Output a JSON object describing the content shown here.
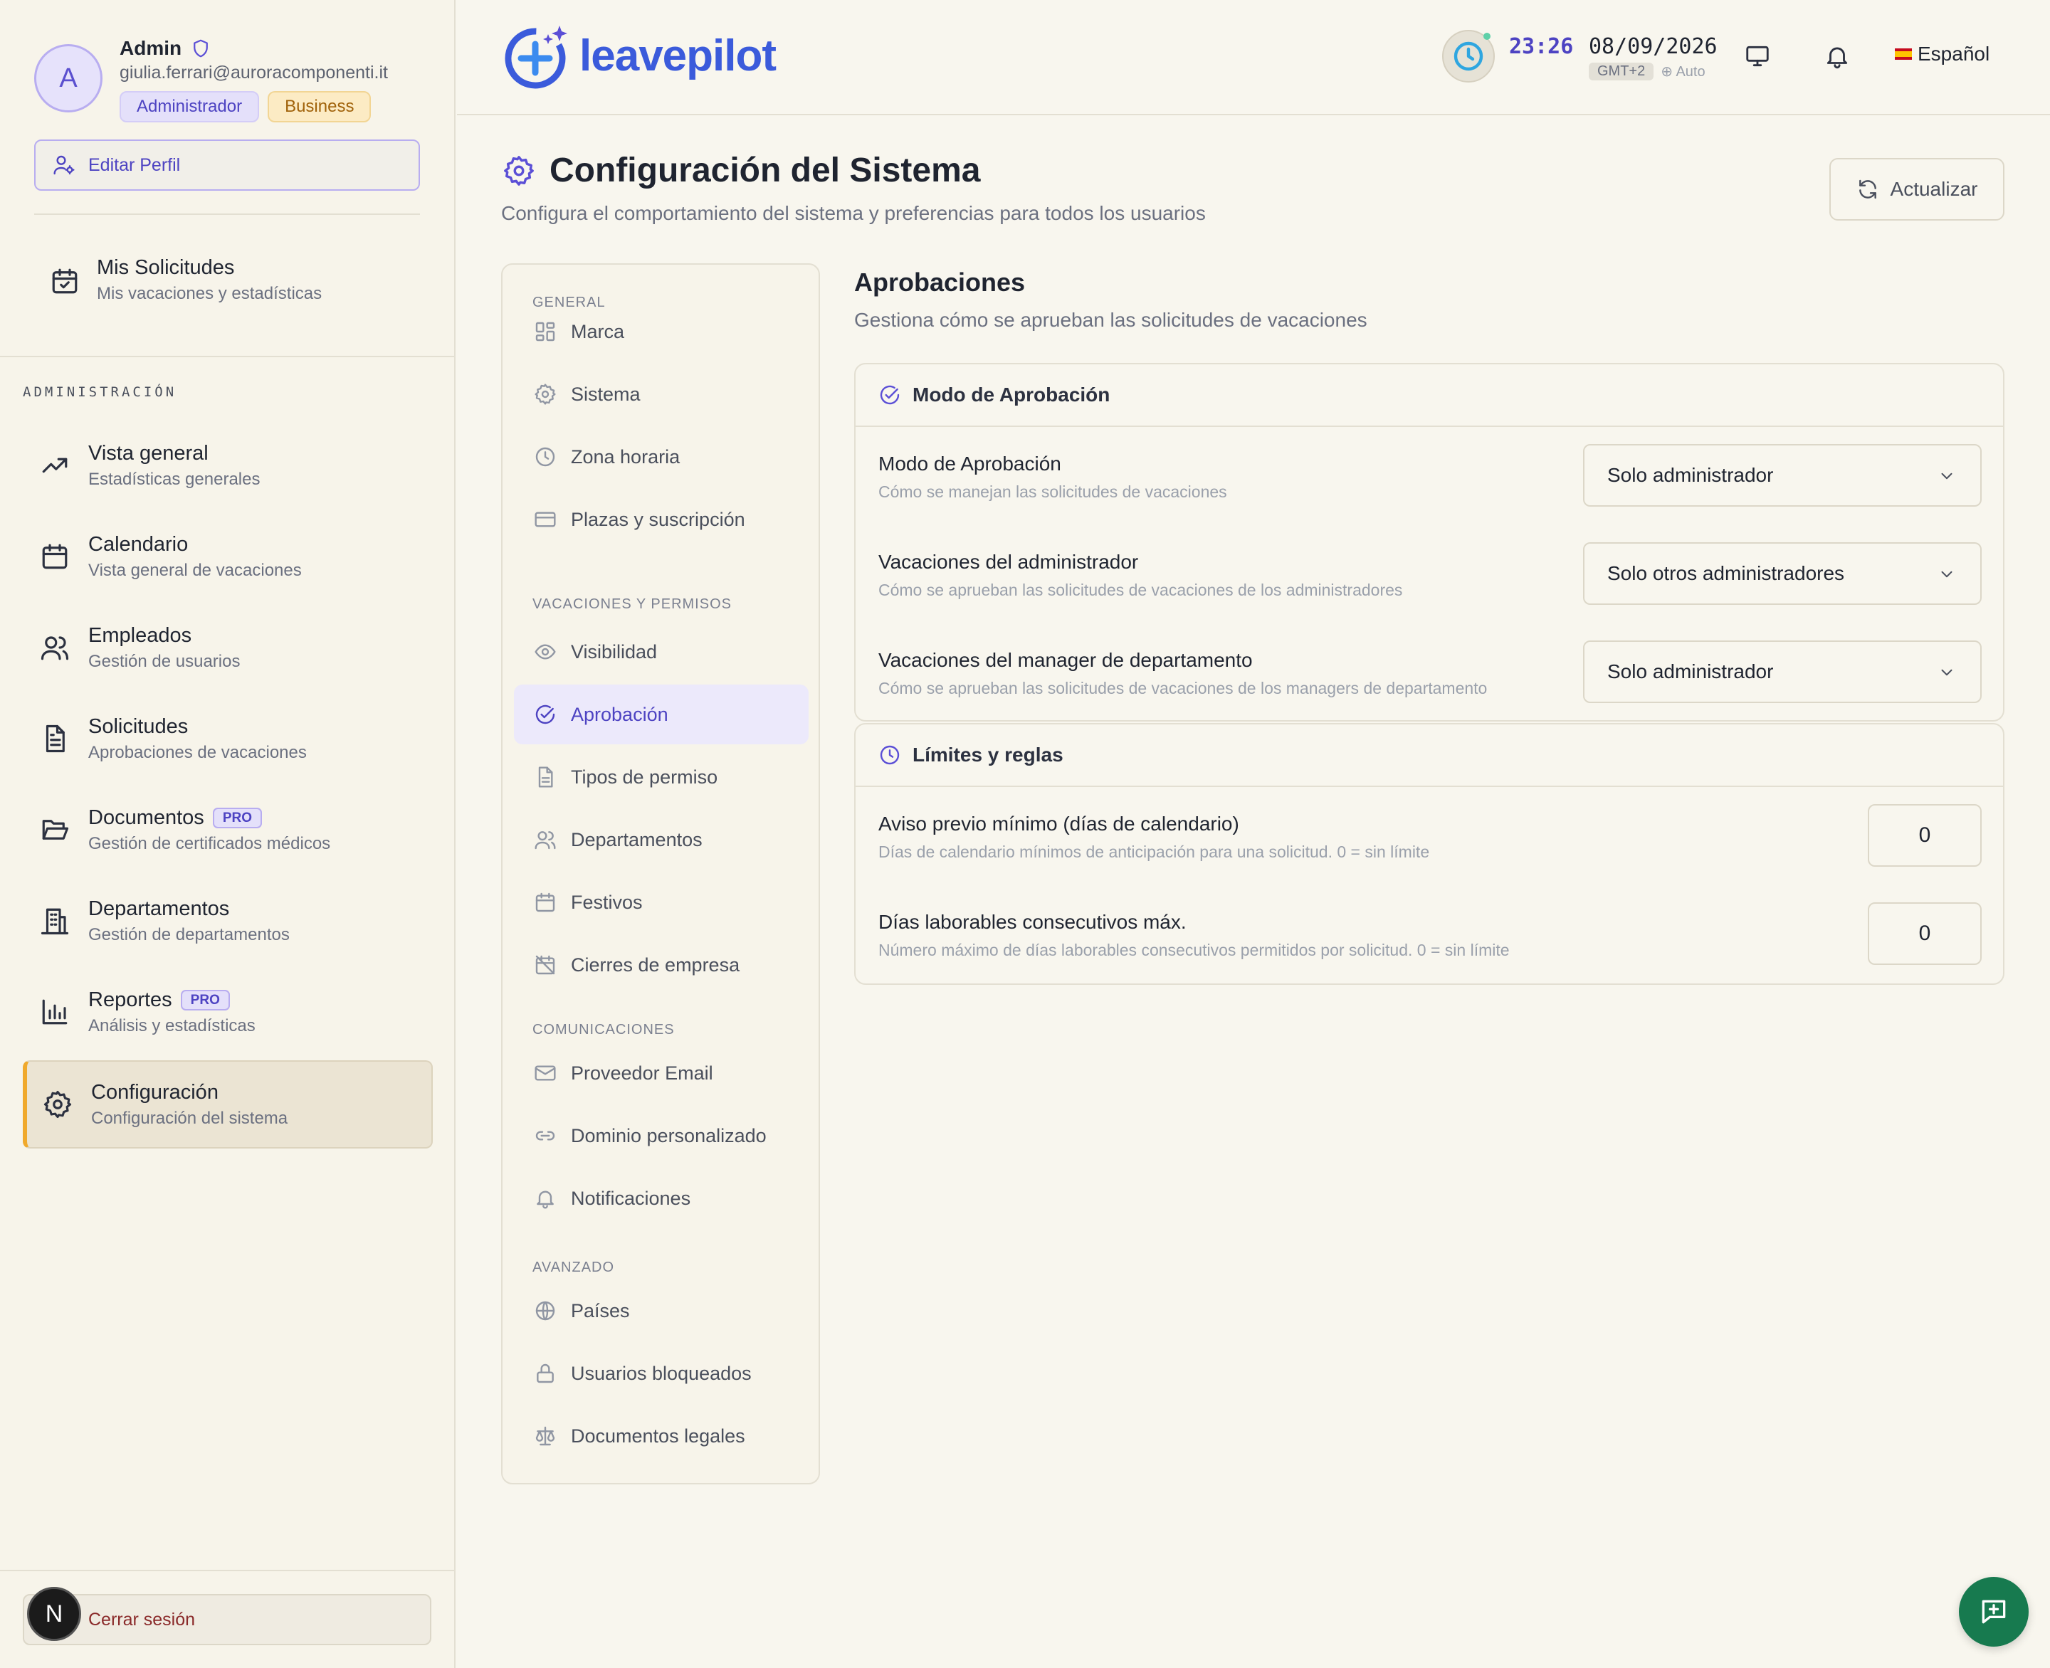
{
  "profile": {
    "avatar_letter": "A",
    "name": "Admin",
    "email": "giulia.ferrari@auroracomponenti.it",
    "role_badge": "Administrador",
    "plan_badge": "Business",
    "edit_label": "Editar Perfil"
  },
  "my_requests": {
    "title": "Mis Solicitudes",
    "subtitle": "Mis vacaciones y estadísticas"
  },
  "admin_section_label": "ADMINISTRACIÓN",
  "nav": [
    {
      "title": "Vista general",
      "subtitle": "Estadísticas generales",
      "icon": "trending-up-icon"
    },
    {
      "title": "Calendario",
      "subtitle": "Vista general de vacaciones",
      "icon": "calendar-icon"
    },
    {
      "title": "Empleados",
      "subtitle": "Gestión de usuarios",
      "icon": "users-icon"
    },
    {
      "title": "Solicitudes",
      "subtitle": "Aprobaciones de vacaciones",
      "icon": "file-text-icon"
    },
    {
      "title": "Documentos",
      "subtitle": "Gestión de certificados médicos",
      "icon": "folder-open-icon",
      "badge": "PRO"
    },
    {
      "title": "Departamentos",
      "subtitle": "Gestión de departamentos",
      "icon": "building-icon"
    },
    {
      "title": "Reportes",
      "subtitle": "Análisis y estadísticas",
      "icon": "bar-chart-icon",
      "badge": "PRO"
    },
    {
      "title": "Configuración",
      "subtitle": "Configuración del sistema",
      "icon": "gear-icon",
      "active": true
    }
  ],
  "logout": {
    "label": "Cerrar sesión",
    "avatar_letter": "N"
  },
  "header": {
    "logo_text": "leavepilot",
    "time": "23:26",
    "date": "08/09/2026",
    "timezone": "GMT+2",
    "tz_mode": "Auto",
    "language": "Español"
  },
  "page": {
    "title": "Configuración del Sistema",
    "subtitle": "Configura el comportamiento del sistema y preferencias para todos los usuarios",
    "refresh_label": "Actualizar"
  },
  "settings_nav": {
    "groups": [
      {
        "label": "GENERAL",
        "items": [
          "Marca",
          "Sistema",
          "Zona horaria",
          "Plazas y suscripción"
        ]
      },
      {
        "label": "VACACIONES Y PERMISOS",
        "items": [
          "Visibilidad",
          "Aprobación",
          "Tipos de permiso",
          "Departamentos",
          "Festivos",
          "Cierres de empresa"
        ]
      },
      {
        "label": "COMUNICACIONES",
        "items": [
          "Proveedor Email",
          "Dominio personalizado",
          "Notificaciones"
        ]
      },
      {
        "label": "AVANZADO",
        "items": [
          "Países",
          "Usuarios bloqueados",
          "Documentos legales"
        ]
      }
    ],
    "active_item": "Aprobación"
  },
  "section": {
    "title": "Aprobaciones",
    "subtitle": "Gestiona cómo se aprueban las solicitudes de vacaciones"
  },
  "approval_card": {
    "title": "Modo de Aprobación",
    "rows": [
      {
        "title": "Modo de Aprobación",
        "desc": "Cómo se manejan las solicitudes de vacaciones",
        "value": "Solo administrador"
      },
      {
        "title": "Vacaciones del administrador",
        "desc": "Cómo se aprueban las solicitudes de vacaciones de los administradores",
        "value": "Solo otros administradores"
      },
      {
        "title": "Vacaciones del manager de departamento",
        "desc": "Cómo se aprueban las solicitudes de vacaciones de los managers de departamento",
        "value": "Solo administrador"
      }
    ]
  },
  "limits_card": {
    "title": "Límites y reglas",
    "rows": [
      {
        "title": "Aviso previo mínimo (días de calendario)",
        "desc": "Días de calendario mínimos de anticipación para una solicitud. 0 = sin límite",
        "value": "0"
      },
      {
        "title": "Días laborables consecutivos máx.",
        "desc": "Número máximo de días laborables consecutivos permitidos por solicitud. 0 = sin límite",
        "value": "0"
      }
    ]
  },
  "colors": {
    "accent": "#5b4fd6",
    "brand_blue": "#3b5bdb",
    "active_border": "#f0a92c",
    "fab": "#177a4f"
  }
}
